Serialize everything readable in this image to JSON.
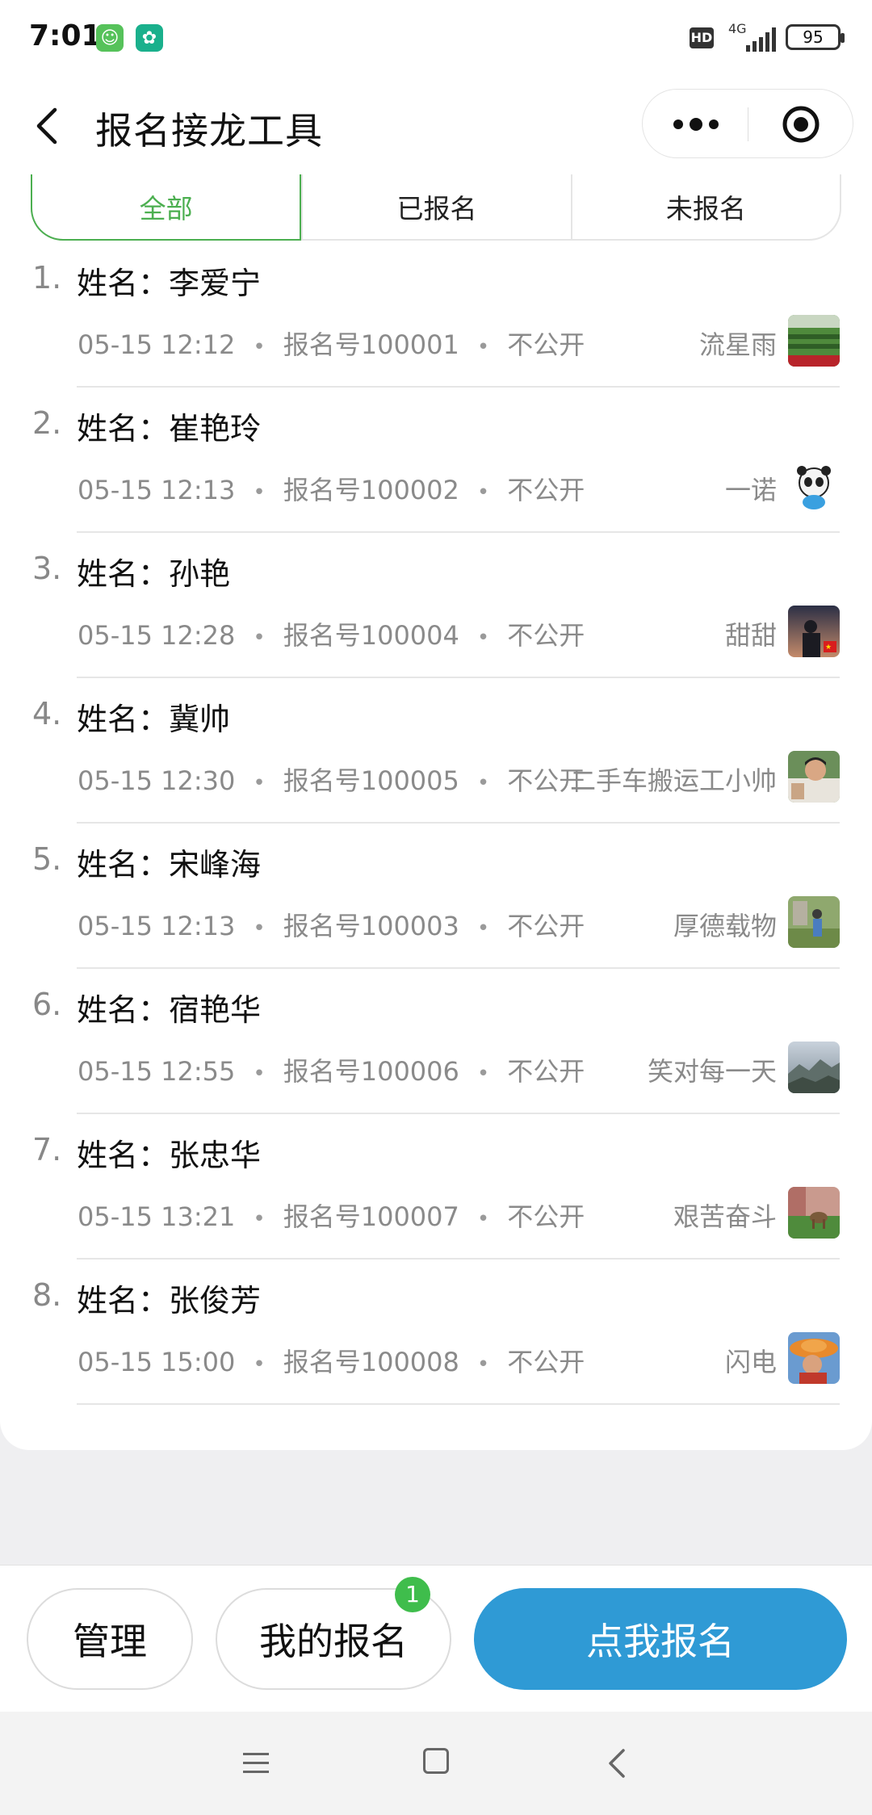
{
  "status_bar": {
    "time": "7:01",
    "hd_label": "HD",
    "network_label": "4G",
    "battery_level": "95"
  },
  "nav": {
    "title": "报名接龙工具"
  },
  "tabs": [
    {
      "label": "全部",
      "active": true
    },
    {
      "label": "已报名",
      "active": false
    },
    {
      "label": "未报名",
      "active": false
    }
  ],
  "entries": [
    {
      "num": "1.",
      "name": "姓名：李爱宁",
      "time": "05-15 12:12",
      "reg_no": "报名号100001",
      "visibility": "不公开",
      "nickname": "流星雨"
    },
    {
      "num": "2.",
      "name": "姓名：崔艳玲",
      "time": "05-15 12:13",
      "reg_no": "报名号100002",
      "visibility": "不公开",
      "nickname": "一诺"
    },
    {
      "num": "3.",
      "name": "姓名：孙艳",
      "time": "05-15 12:28",
      "reg_no": "报名号100004",
      "visibility": "不公开",
      "nickname": "甜甜"
    },
    {
      "num": "4.",
      "name": "姓名：冀帅",
      "time": "05-15 12:30",
      "reg_no": "报名号100005",
      "visibility": "不公开",
      "nickname": "二手车搬运工小帅"
    },
    {
      "num": "5.",
      "name": "姓名：宋峰海",
      "time": "05-15 12:13",
      "reg_no": "报名号100003",
      "visibility": "不公开",
      "nickname": "厚德载物"
    },
    {
      "num": "6.",
      "name": "姓名：宿艳华",
      "time": "05-15 12:55",
      "reg_no": "报名号100006",
      "visibility": "不公开",
      "nickname": "笑对每一天"
    },
    {
      "num": "7.",
      "name": "姓名：张忠华",
      "time": "05-15 13:21",
      "reg_no": "报名号100007",
      "visibility": "不公开",
      "nickname": "艰苦奋斗"
    },
    {
      "num": "8.",
      "name": "姓名：张俊芳",
      "time": "05-15 15:00",
      "reg_no": "报名号100008",
      "visibility": "不公开",
      "nickname": "闪电"
    }
  ],
  "actions": {
    "manage_label": "管理",
    "my_signup_label": "我的报名",
    "my_signup_badge": "1",
    "signup_label": "点我报名"
  },
  "colors": {
    "accent_green": "#4caf50",
    "primary_blue": "#2f9ad5",
    "badge_green": "#3fbd4c"
  }
}
